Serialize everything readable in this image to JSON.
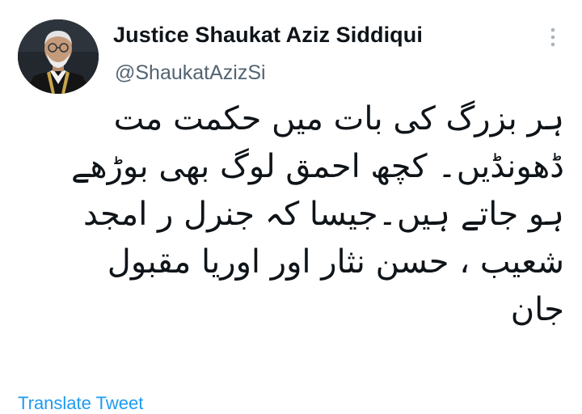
{
  "author": {
    "display_name": "Justice Shaukat Aziz Siddiqui",
    "handle": "@ShaukatAzizSi",
    "avatar_icon": "profile-photo"
  },
  "menu": {
    "icon": "more-vertical-icon"
  },
  "tweet": {
    "lines": [
      "ہر بزرگ کی بات میں حکمت مت",
      "ڈھونڈیں۔ کچھ احمق لوگ بھی بوڑھے",
      "ہو جاتے ہیں۔جیسا کہ  جنرل ر امجد",
      "شعیب ، حسن نثار اور اوریا مقبول",
      "جان"
    ]
  },
  "footer": {
    "translate_label": "Translate Tweet"
  },
  "colors": {
    "text": "#0f1419",
    "secondary": "#536471",
    "accent": "#1d9bf0"
  }
}
